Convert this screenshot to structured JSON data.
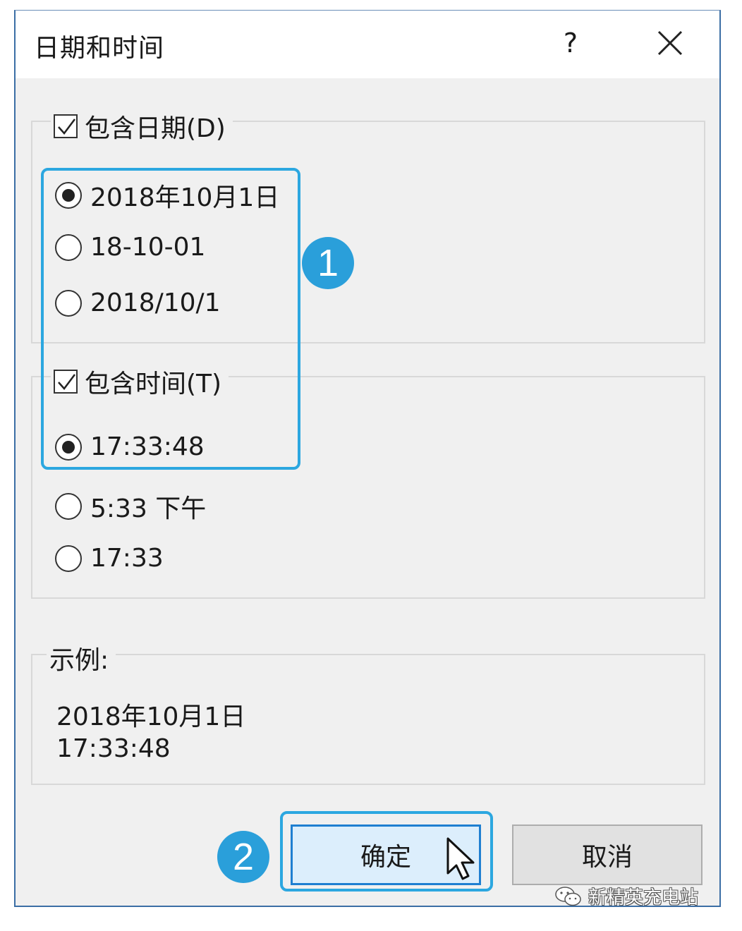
{
  "window": {
    "title": "日期和时间",
    "help_label": "?"
  },
  "date_group": {
    "checkbox_label": "包含日期(D)",
    "checked": true,
    "options": [
      "2018年10月1日",
      "18-10-01",
      "2018/10/1"
    ],
    "selected_index": 0
  },
  "time_group": {
    "checkbox_label": "包含时间(T)",
    "checked": true,
    "options": [
      "17:33:48",
      "5:33 下午",
      "17:33"
    ],
    "selected_index": 0
  },
  "sample": {
    "label": "示例:",
    "line1": "2018年10月1日",
    "line2": "17:33:48"
  },
  "buttons": {
    "ok": "确定",
    "cancel": "取消"
  },
  "annotations": {
    "badge1": "1",
    "badge2": "2",
    "highlight_color": "#2ca7e0",
    "badge_color": "#2a9fda"
  },
  "watermark": {
    "text": "新精英充电站"
  }
}
